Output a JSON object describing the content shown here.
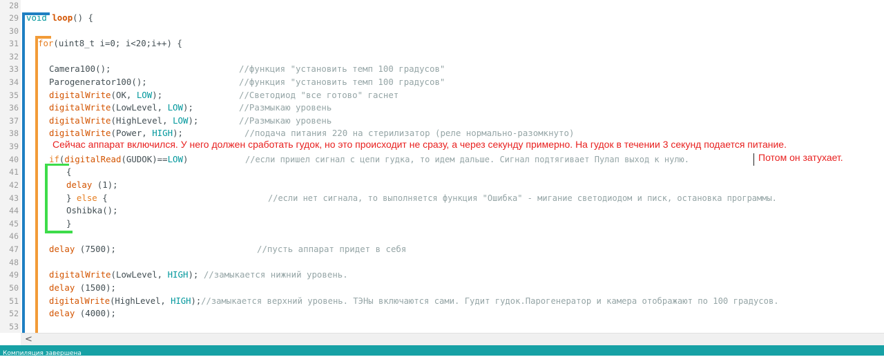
{
  "editor": {
    "line_numbers": [
      "28",
      "29",
      "30",
      "31",
      "32",
      "33",
      "34",
      "35",
      "36",
      "37",
      "38",
      "39",
      "40",
      "41",
      "42",
      "43",
      "44",
      "45",
      "46",
      "47",
      "48",
      "49",
      "50",
      "51",
      "52",
      "53"
    ]
  },
  "code": {
    "l29": {
      "t1": "void",
      "t2": "loop",
      "t3": "() {"
    },
    "l31": {
      "t1": "for",
      "t2": "(",
      "t3": "uint8_t",
      "t4": " i=0; i<20;i++) {"
    },
    "l33": {
      "t1": "Camera100();",
      "t2": "//функция \"установить темп 100 градусов\""
    },
    "l34": {
      "t1": "Parogenerator100();",
      "t2": "//функция \"установить темп 100 градусов\""
    },
    "l35": {
      "t1": "digitalWrite",
      "t2": "(OK, ",
      "t3": "LOW",
      "t4": ");",
      "t5": "//Светодиод \"все готово\" гаснет"
    },
    "l36": {
      "t1": "digitalWrite",
      "t2": "(LowLevel, ",
      "t3": "LOW",
      "t4": ");",
      "t5": "//Размыкаю уровень"
    },
    "l37": {
      "t1": "digitalWrite",
      "t2": "(HighLevel, ",
      "t3": "LOW",
      "t4": ");",
      "t5": "//Размыкаю уровень"
    },
    "l38": {
      "t1": "digitalWrite",
      "t2": "(Power, ",
      "t3": "HIGH",
      "t4": ");",
      "t5": "//подача питания 220 на стерилизатор (реле нормально-разомкнуто)"
    },
    "l40": {
      "t1": "if",
      "t2": "(",
      "t3": "digitalRead",
      "t4": "(GUDOK)==",
      "t5": "LOW",
      "t6": ")",
      "t7": "//если пришел сигнал с цепи гудка, то идем дальше. Сигнал подтягивает Пулап выход к нулю."
    },
    "l41": {
      "t1": "{"
    },
    "l42": {
      "t1": "delay",
      "t2": " (1);"
    },
    "l43": {
      "t1": "} ",
      "t2": "else",
      "t3": " {",
      "t4": "//если нет сигнала, то выполняется функция \"Ошибка\" - мигание светодиодом и писк, остановка программы."
    },
    "l44": {
      "t1": "Oshibka();"
    },
    "l45": {
      "t1": "}"
    },
    "l47": {
      "t1": "delay",
      "t2": " (7500);",
      "t3": "//пусть аппарат придет в себя"
    },
    "l49": {
      "t1": "digitalWrite",
      "t2": "(LowLevel, ",
      "t3": "HIGH",
      "t4": ");",
      "t5": " //замыкается нижний уровень."
    },
    "l50": {
      "t1": "delay",
      "t2": " (1500);"
    },
    "l51": {
      "t1": "digitalWrite",
      "t2": "(HighLevel, ",
      "t3": "HIGH",
      "t4": ");",
      "t5": "//замыкается верхний уровень. ТЭНы включаются сами. Гудит гудок.Парогенератор и камера отображают по 100 градусов."
    },
    "l52": {
      "t1": "delay",
      "t2": " (4000);"
    }
  },
  "notes": {
    "line39": "Сейчас аппарат включился. У него должен сработать гудок, но это происходит не сразу, а через секунду примерно. На гудок в течении 3 секунд подается питание.",
    "line40": "Потом он затухает."
  },
  "scrollbar": {
    "left_arrow": "<"
  },
  "console": {
    "status": "Компиляция завершена"
  },
  "colors": {
    "keyword": "#d35400",
    "constant": "#00979c",
    "comment": "#95a5a6",
    "annotation_red": "#e8201f",
    "bracket_blue": "#1e7fc2",
    "bracket_orange": "#f29b38",
    "bracket_green": "#3ddc4a",
    "console_bar": "#17a1a5"
  }
}
